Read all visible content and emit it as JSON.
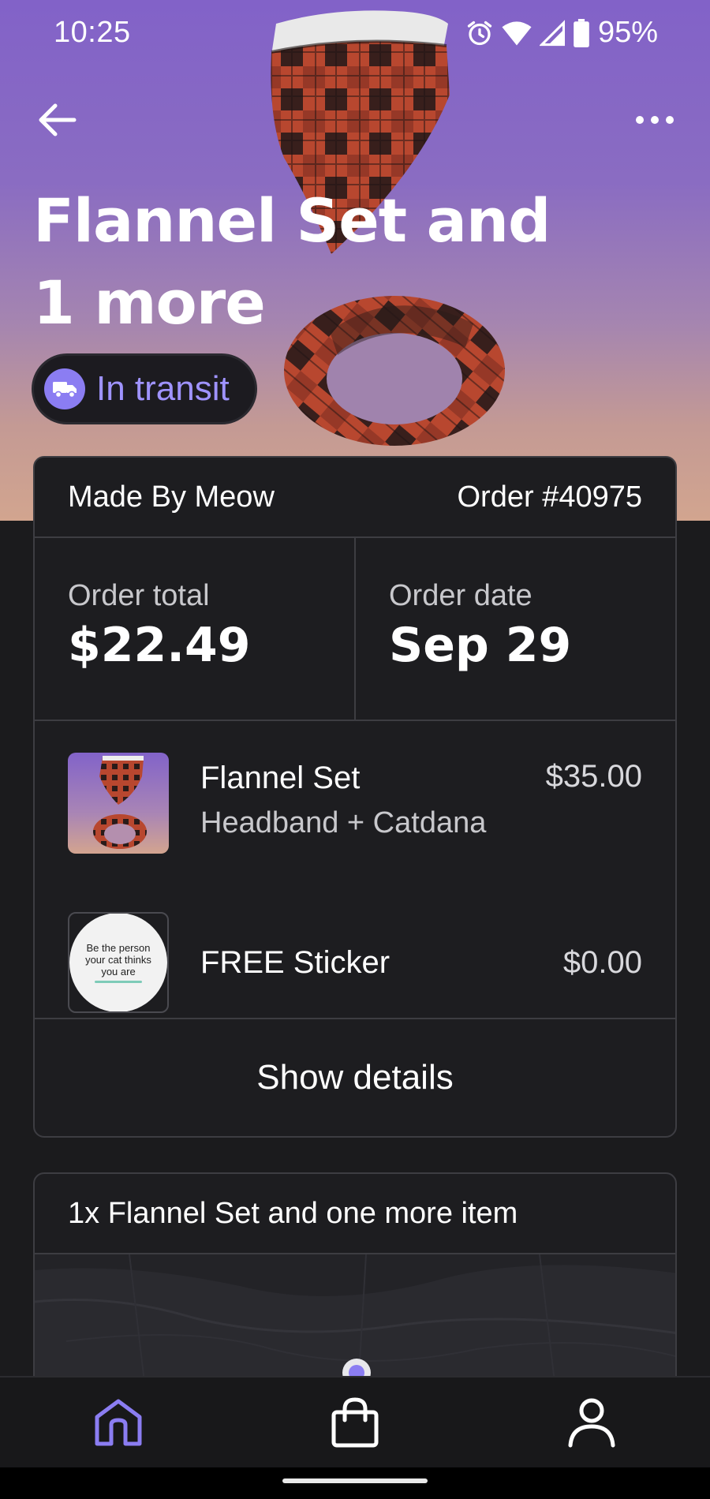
{
  "status_bar": {
    "time": "10:25",
    "battery": "95%",
    "icons": [
      "alarm-icon",
      "wifi-icon",
      "signal-icon",
      "battery-icon"
    ]
  },
  "header": {
    "title": "Flannel Set and 1 more",
    "status": "In transit",
    "status_icon": "truck-icon"
  },
  "order": {
    "shop": "Made By Meow",
    "number": "Order #40975",
    "total_label": "Order total",
    "total_value": "$22.49",
    "date_label": "Order date",
    "date_value": "Sep 29",
    "items": [
      {
        "name": "Flannel Set",
        "variant": "Headband + Catdana",
        "price": "$35.00"
      },
      {
        "name": "FREE Sticker",
        "variant": "",
        "price": "$0.00",
        "sticker_text": "Be the person your cat thinks you are"
      }
    ],
    "show_details": "Show details"
  },
  "tracking": {
    "title": "1x Flannel Set and one more item"
  },
  "nav": {
    "items": [
      "home-icon",
      "bag-icon",
      "person-icon"
    ],
    "active": "home-icon"
  },
  "colors": {
    "accent": "#8b7df2",
    "background": "#1b1b1d",
    "card": "#1d1d20",
    "hero_top": "#8262c8",
    "hero_bottom": "#d2a58f"
  }
}
